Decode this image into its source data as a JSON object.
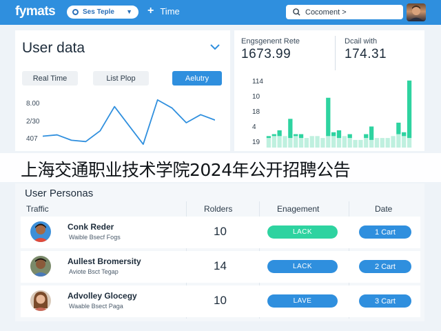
{
  "topbar": {
    "logo": "fymats",
    "select_label": "Ses Teple",
    "time_label": "Time",
    "search_text": "Cocoment >"
  },
  "user_data": {
    "title": "User data",
    "tabs": [
      "Real Time",
      "List Plop",
      "Aelutry"
    ],
    "y_labels": [
      "8.00",
      "2/30",
      "407"
    ]
  },
  "stats": {
    "engagement_label": "Engsgenent Rete",
    "engagement_value": "1673.99",
    "detail_label": "Dcail with",
    "detail_value": "174.31",
    "y_ticks": [
      "114",
      "10",
      "18",
      "4",
      "19"
    ]
  },
  "banner": {
    "text": "上海交通职业技术学院2024年公开招聘公告"
  },
  "personas": {
    "title": "User Personas",
    "headers": [
      "Traffic",
      "Rolders",
      "Enagement",
      "Date"
    ],
    "rows": [
      {
        "name": "Conk Reder",
        "sub": "Waible Bsecf Fogs",
        "num": "10",
        "status": "LACK",
        "date": "1 Cart"
      },
      {
        "name": "Aullest Bromersity",
        "sub": "Aviote Bsct Tegap",
        "num": "14",
        "status": "LACK",
        "date": "2 Cart"
      },
      {
        "name": "Advolley Glocegy",
        "sub": "Waable Bsect Paga",
        "num": "10",
        "status": "LAVE",
        "date": "3 Cart"
      }
    ]
  },
  "colors": {
    "primary": "#2f8fde",
    "accent_teal": "#2ed3a0",
    "bar_light": "#bff0df"
  },
  "chart_data": [
    {
      "type": "line",
      "title": "",
      "x": [
        0,
        1,
        2,
        3,
        4,
        5,
        6,
        7,
        8,
        9,
        10,
        11,
        12
      ],
      "series": [
        {
          "values": [
            20,
            22,
            14,
            12,
            28,
            64,
            36,
            8,
            74,
            62,
            40,
            52,
            44
          ]
        }
      ]
    },
    {
      "type": "bar",
      "title": "",
      "series": [
        {
          "values": [
            10,
            12,
            12,
            12,
            10,
            12,
            10,
            10,
            12,
            12,
            10,
            12,
            12,
            10,
            12,
            10,
            8,
            8,
            10,
            8,
            10,
            10,
            10,
            12,
            14,
            12,
            10
          ]
        },
        {
          "values": [
            12,
            14,
            18,
            10,
            30,
            14,
            14,
            10,
            10,
            12,
            10,
            52,
            16,
            18,
            10,
            14,
            8,
            8,
            14,
            22,
            8,
            10,
            10,
            12,
            26,
            16,
            70
          ]
        }
      ]
    }
  ]
}
